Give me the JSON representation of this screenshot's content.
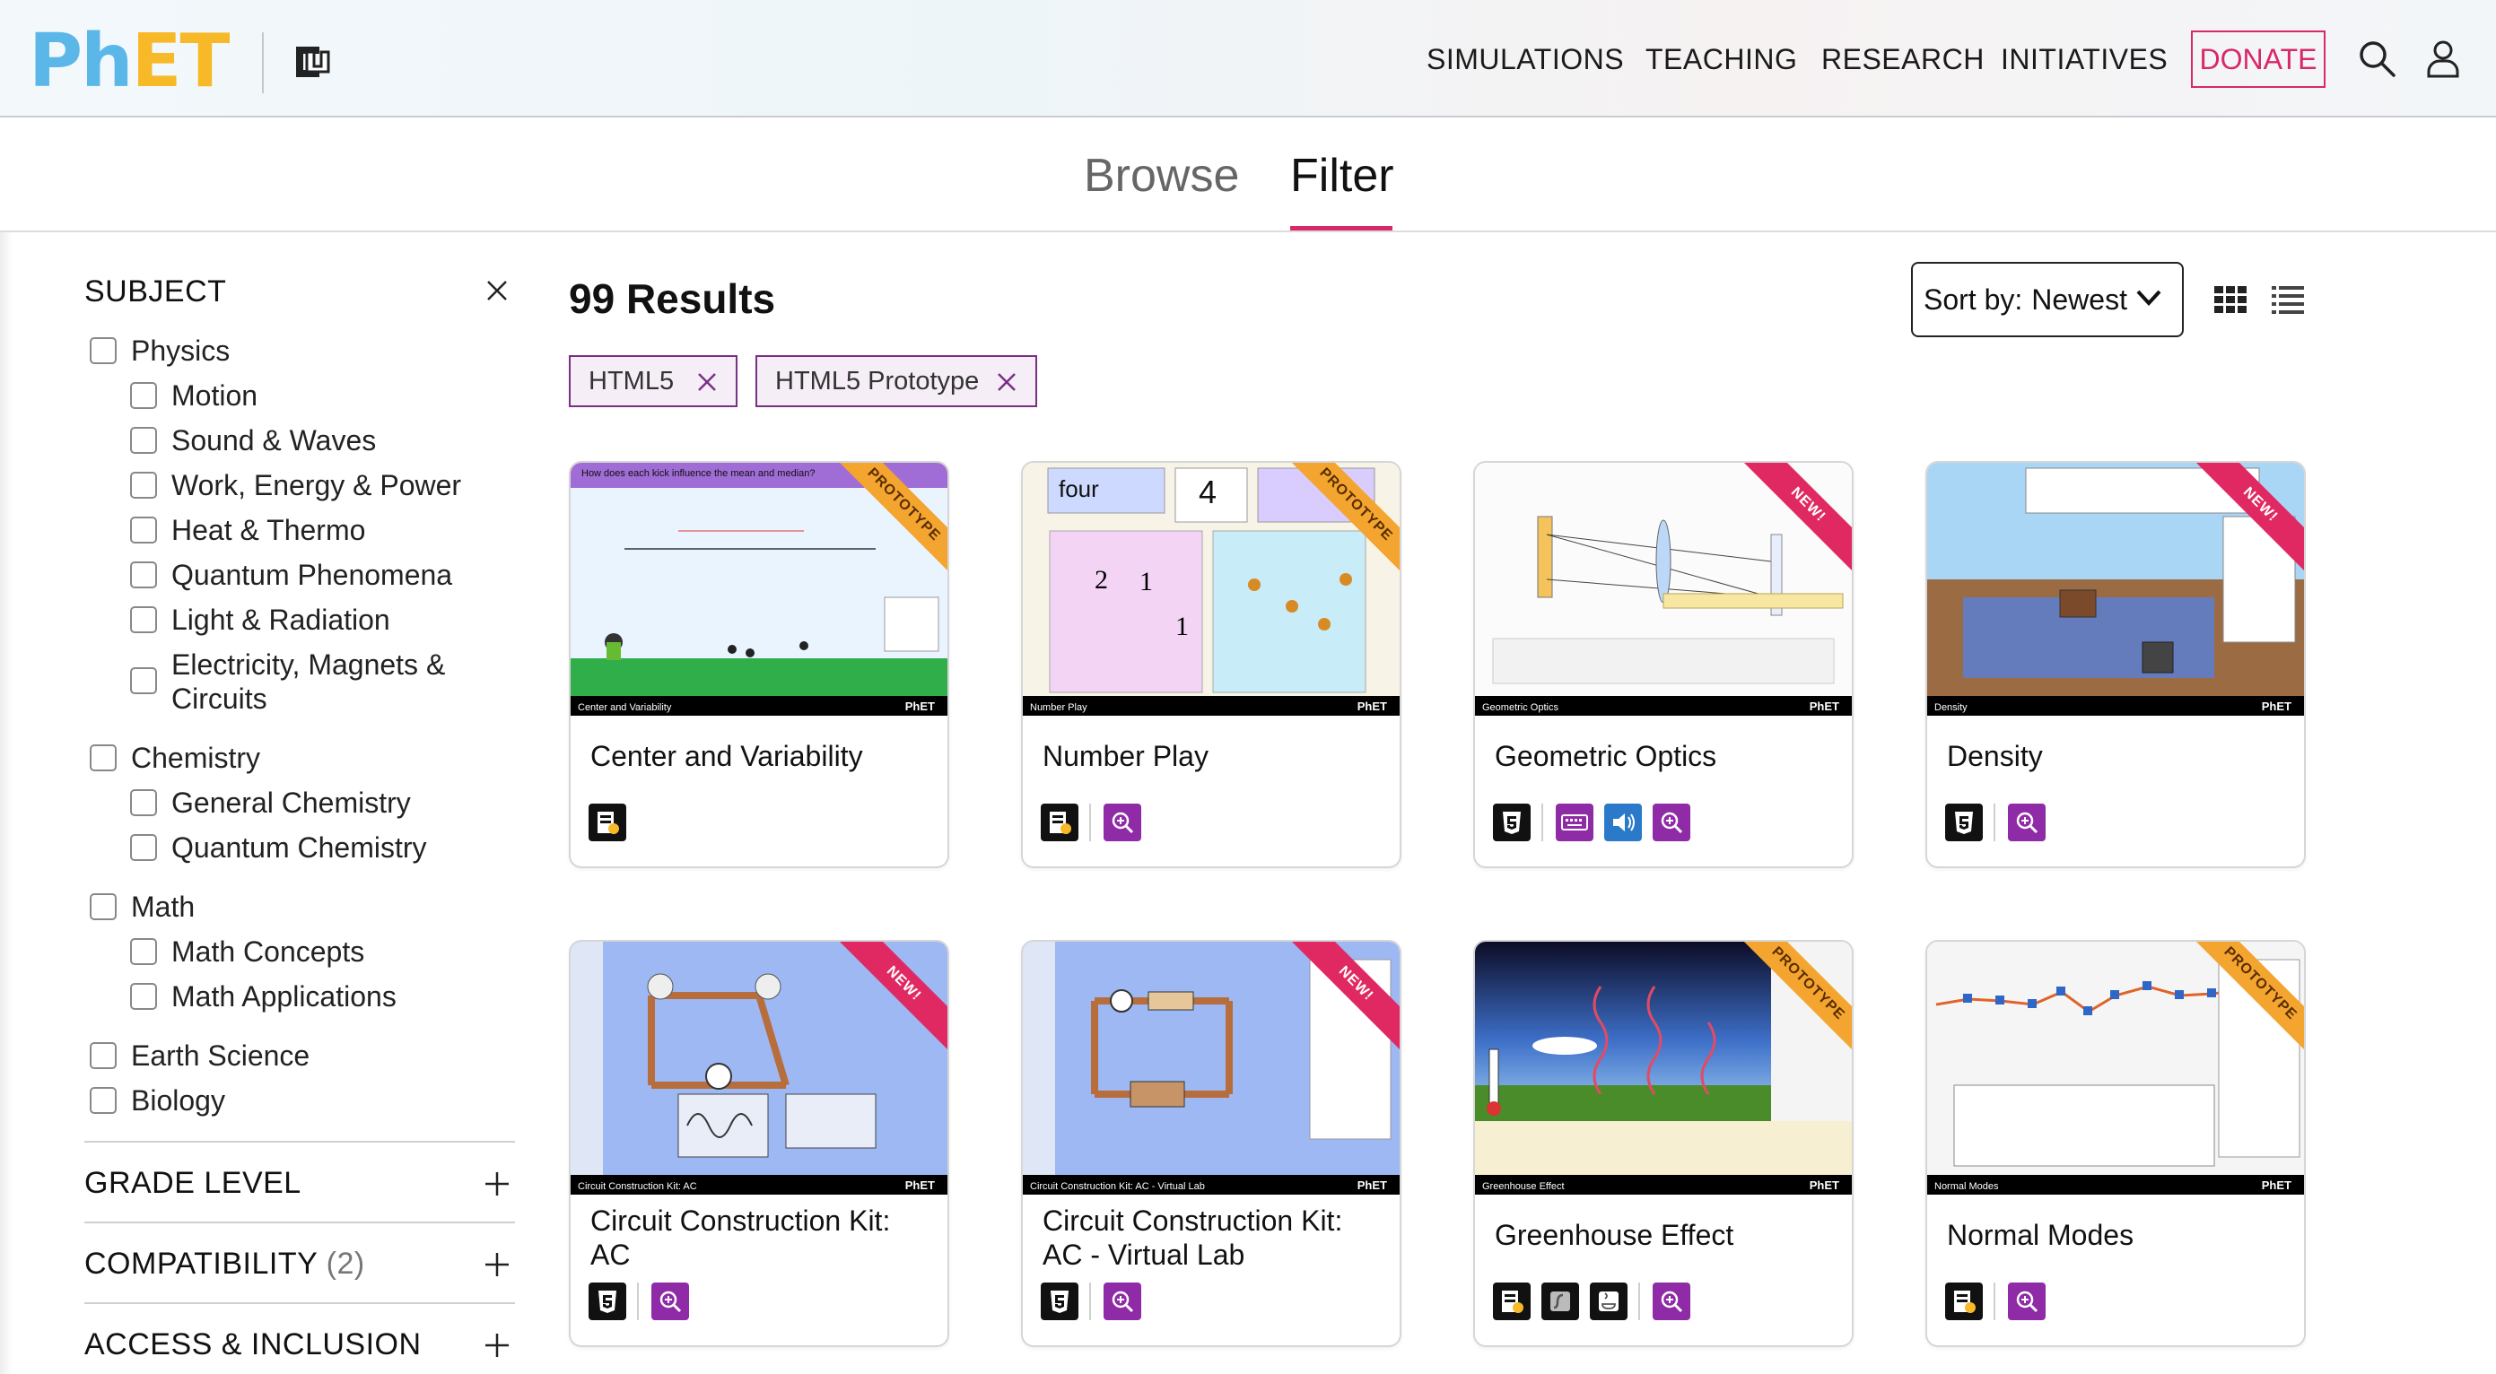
{
  "header": {
    "logo_ph": "PhET",
    "nav": [
      "SIMULATIONS",
      "TEACHING",
      "RESEARCH",
      "INITIATIVES"
    ],
    "donate": "DONATE",
    "icons": [
      "search-icon",
      "user-icon"
    ]
  },
  "tabs": {
    "browse": "Browse",
    "filter": "Filter"
  },
  "sidebar": {
    "subject_title": "SUBJECT",
    "physics": {
      "label": "Physics",
      "children": [
        "Motion",
        "Sound & Waves",
        "Work, Energy & Power",
        "Heat & Thermo",
        "Quantum Phenomena",
        "Light & Radiation",
        "Electricity, Magnets &",
        "Circuits"
      ]
    },
    "chemistry": {
      "label": "Chemistry",
      "children": [
        "General Chemistry",
        "Quantum Chemistry"
      ]
    },
    "math": {
      "label": "Math",
      "children": [
        "Math Concepts",
        "Math Applications"
      ]
    },
    "earth": "Earth Science",
    "biology": "Biology",
    "grade_level": "GRADE LEVEL",
    "compatibility": "COMPATIBILITY",
    "compatibility_count": "(2)",
    "access": "ACCESS & INCLUSION"
  },
  "results": {
    "count_label": "99 Results",
    "sort_label": "Sort by:",
    "sort_value": "Newest",
    "chips": [
      "HTML5",
      "HTML5 Prototype"
    ]
  },
  "cards": [
    {
      "title": "Center and Variability",
      "ribbon": "PROTOTYPE",
      "bar": "Center and Variability",
      "thumb_heading": "How does each kick influence the mean and median?"
    },
    {
      "title": "Number Play",
      "ribbon": "PROTOTYPE",
      "bar": "Number Play",
      "thumb_word": "four",
      "thumb_num": "4"
    },
    {
      "title": "Geometric Optics",
      "ribbon": "NEW!",
      "bar": "Geometric Optics"
    },
    {
      "title": "Density",
      "ribbon": "NEW!",
      "bar": "Density"
    },
    {
      "title_line1": "Circuit Construction Kit:",
      "title_line2": "AC",
      "ribbon": "NEW!",
      "bar": "Circuit Construction Kit: AC"
    },
    {
      "title_line1": "Circuit Construction Kit:",
      "title_line2": "AC - Virtual Lab",
      "ribbon": "NEW!",
      "bar": "Circuit Construction Kit: AC - Virtual Lab"
    },
    {
      "title": "Greenhouse Effect",
      "ribbon": "PROTOTYPE",
      "bar": "Greenhouse Effect"
    },
    {
      "title": "Normal Modes",
      "ribbon": "PROTOTYPE",
      "bar": "Normal Modes"
    }
  ],
  "thumb_phet": "PhET",
  "colors": {
    "accent": "#d8286a",
    "chip_border": "#7a2f86",
    "phet_blue": "#5bb7e8",
    "phet_yellow": "#f7b928"
  }
}
